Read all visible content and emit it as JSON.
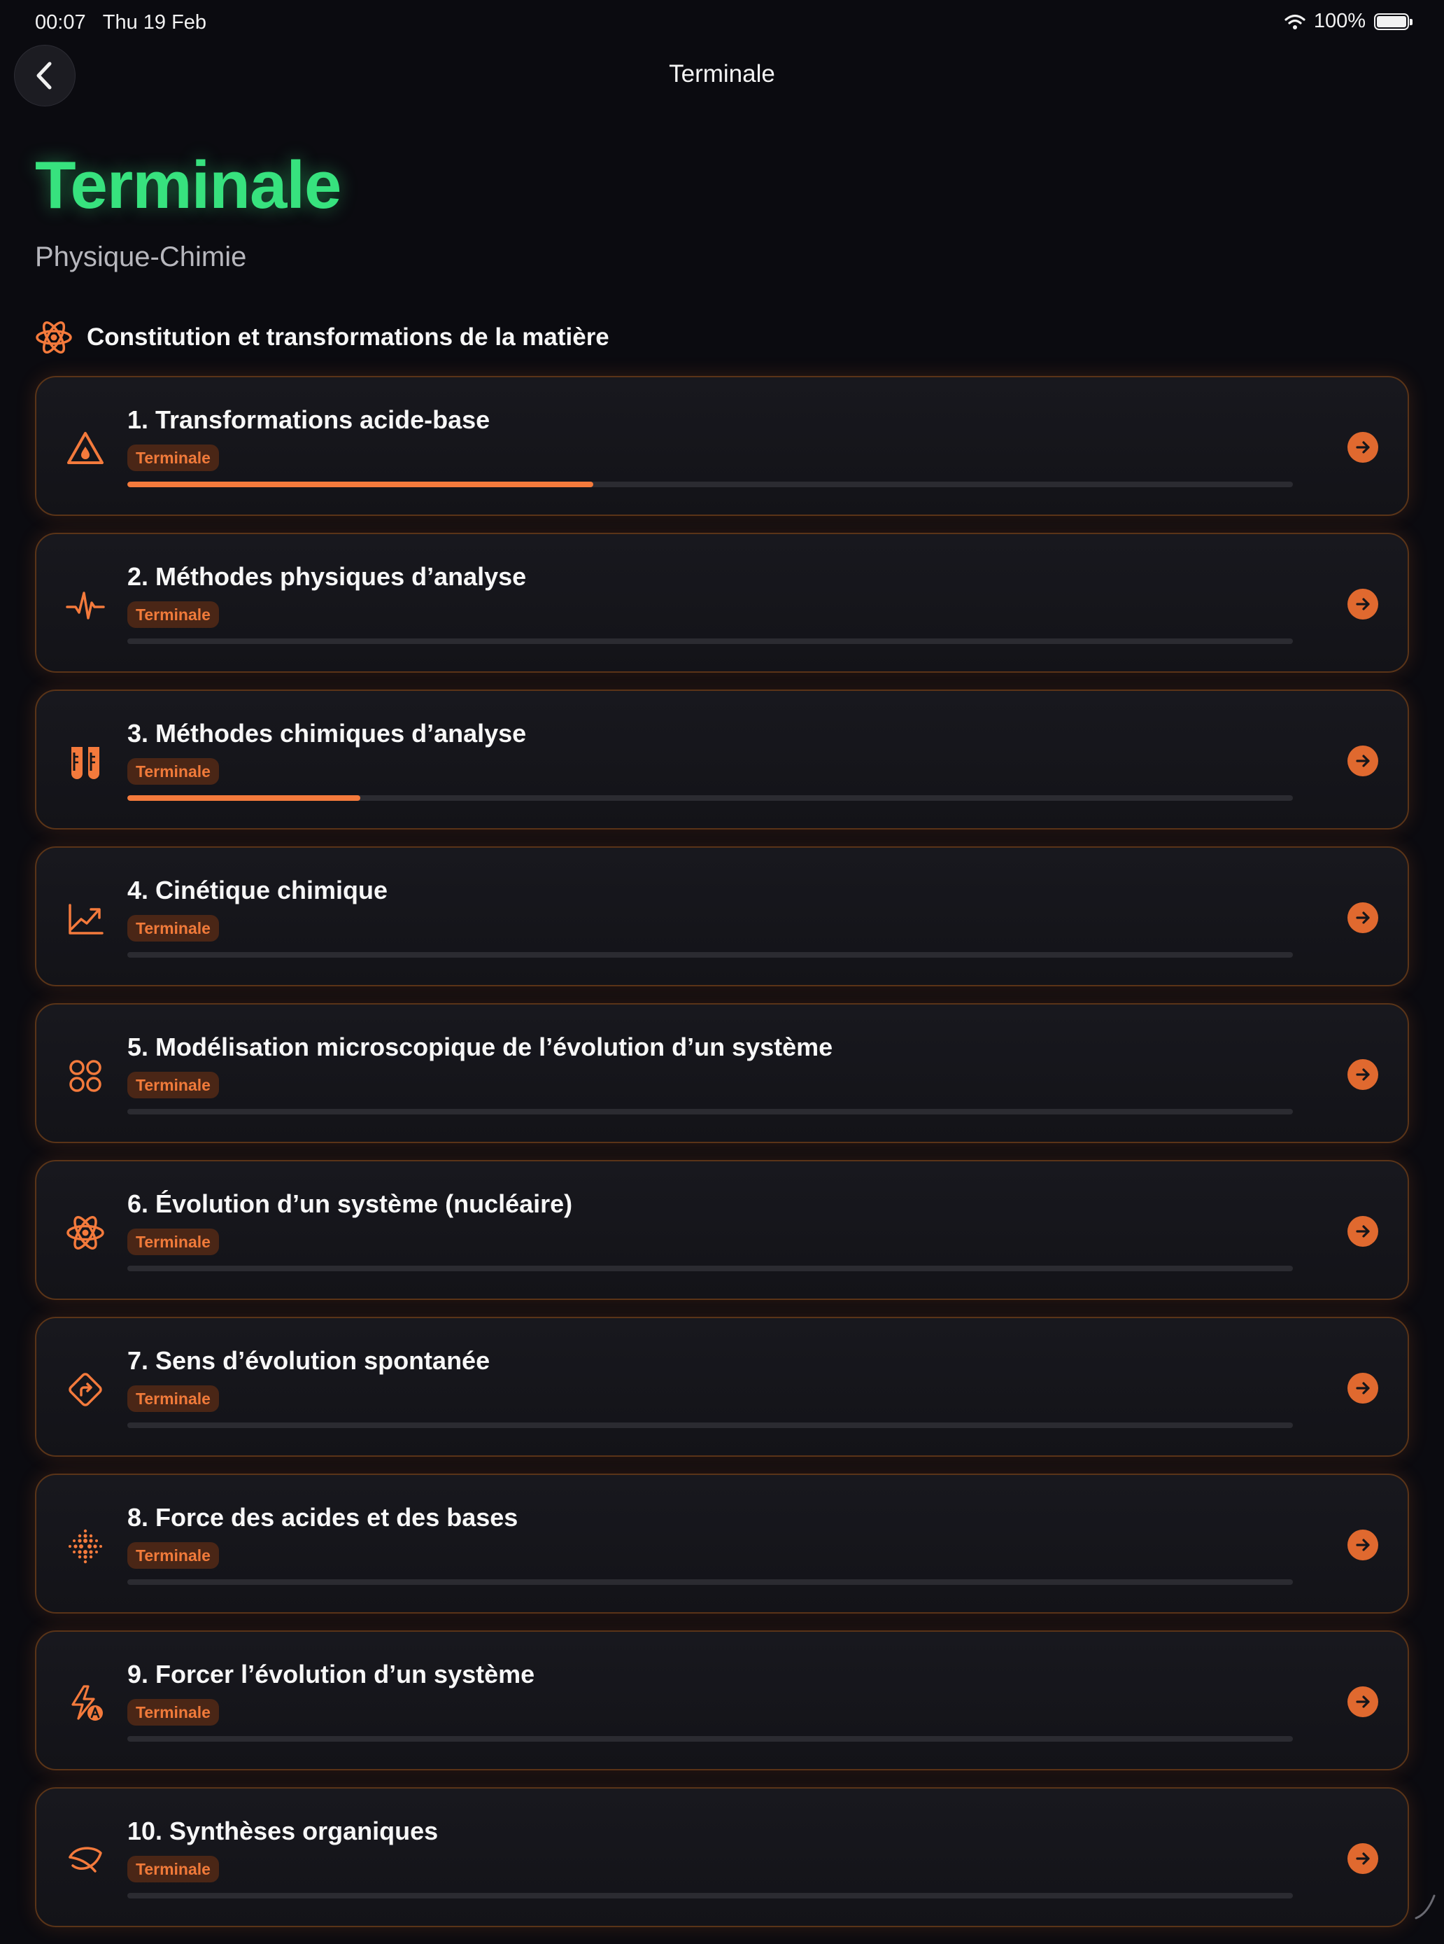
{
  "status_bar": {
    "time": "00:07",
    "date": "Thu 19 Feb",
    "battery": "100%"
  },
  "nav": {
    "title": "Terminale"
  },
  "header": {
    "title": "Terminale",
    "subtitle": "Physique-Chimie"
  },
  "section": {
    "title": "Constitution et transformations de la matière",
    "icon": "atom-icon"
  },
  "chapters": [
    {
      "title": "1. Transformations acide-base",
      "badge": "Terminale",
      "progress": 0.4,
      "icon": "flask-drop-icon"
    },
    {
      "title": "2. Méthodes physiques d’analyse",
      "badge": "Terminale",
      "progress": 0,
      "icon": "waveform-icon"
    },
    {
      "title": "3. Méthodes chimiques d’analyse",
      "badge": "Terminale",
      "progress": 0.2,
      "icon": "test-tubes-icon"
    },
    {
      "title": "4. Cinétique chimique",
      "badge": "Terminale",
      "progress": 0,
      "icon": "trend-chart-icon"
    },
    {
      "title": "5. Modélisation microscopique de l’évolution d’un système",
      "badge": "Terminale",
      "progress": 0,
      "icon": "four-circles-icon"
    },
    {
      "title": "6. Évolution d’un système (nucléaire)",
      "badge": "Terminale",
      "progress": 0,
      "icon": "atom-icon"
    },
    {
      "title": "7. Sens d’évolution spontanée",
      "badge": "Terminale",
      "progress": 0,
      "icon": "turn-sign-icon"
    },
    {
      "title": "8. Force des acides et des bases",
      "badge": "Terminale",
      "progress": 0,
      "icon": "dot-grid-icon"
    },
    {
      "title": "9. Forcer l’évolution d’un système",
      "badge": "Terminale",
      "progress": 0,
      "icon": "bolt-icon"
    },
    {
      "title": "10. Synthèses organiques",
      "badge": "Terminale",
      "progress": 0,
      "icon": "leaf-icon"
    }
  ],
  "colors": {
    "accent": "#f47a3c",
    "title_green": "#37e27e",
    "background": "#0b0b10"
  }
}
